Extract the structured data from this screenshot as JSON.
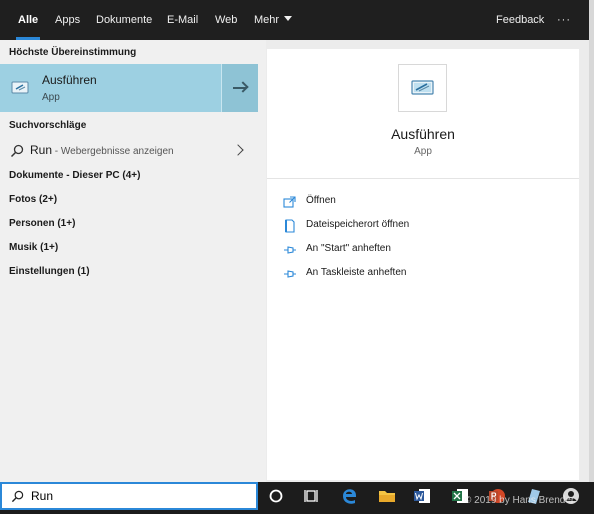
{
  "tabs": [
    {
      "label": "Alle",
      "active": true
    },
    {
      "label": "Apps"
    },
    {
      "label": "Dokumente"
    },
    {
      "label": "E-Mail"
    },
    {
      "label": "Web"
    },
    {
      "label": "Mehr"
    }
  ],
  "feedback_label": "Feedback",
  "more_options_label": "···",
  "best_match": {
    "heading": "Höchste Übereinstimmung",
    "title": "Ausführen",
    "subtitle": "App"
  },
  "suggestions": {
    "heading": "Suchvorschläge",
    "query": "Run",
    "suffix": " - Webergebnisse anzeigen"
  },
  "categories": [
    "Dokumente - Dieser PC (4+)",
    "Fotos (2+)",
    "Personen (1+)",
    "Musik (1+)",
    "Einstellungen (1)"
  ],
  "detail": {
    "title": "Ausführen",
    "subtitle": "App",
    "actions": [
      {
        "label": "Öffnen",
        "icon": "open-icon"
      },
      {
        "label": "Dateispeicherort öffnen",
        "icon": "file-location-icon"
      },
      {
        "label": "An \"Start\" anheften",
        "icon": "pin-icon"
      },
      {
        "label": "An Taskleiste anheften",
        "icon": "pin-icon"
      }
    ]
  },
  "taskbar": {
    "search_value": "Run",
    "copyright": "© 2019 by Hans Brender"
  },
  "colors": {
    "accent": "#2b88d8",
    "selected": "#9dd0e2",
    "topbar": "#1f1f1f",
    "taskbar": "#1c1c1c"
  }
}
